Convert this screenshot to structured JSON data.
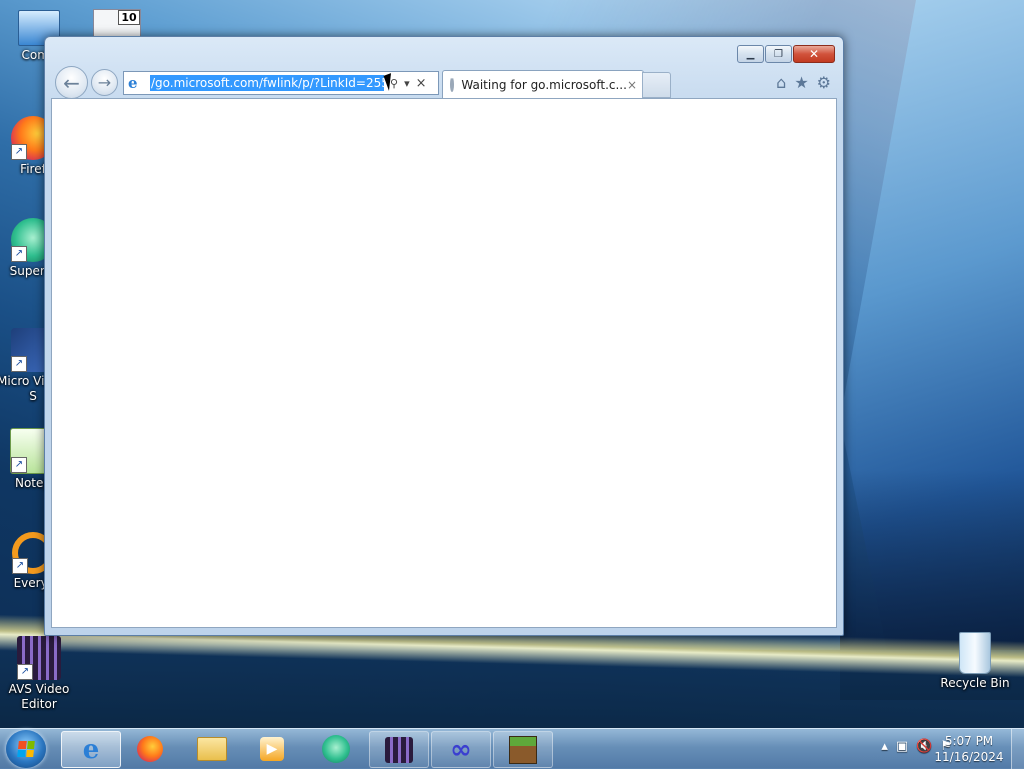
{
  "desktop": {
    "icons": [
      {
        "label": "Comp"
      },
      {
        "label": "Firef"
      },
      {
        "label": "Superm"
      },
      {
        "label": "Micro Visual S"
      },
      {
        "label": "Notep"
      },
      {
        "label": "Everyt"
      },
      {
        "label": "AVS Video Editor"
      },
      {
        "label": "Recycle Bin"
      }
    ],
    "badge_number": "10"
  },
  "browser": {
    "address": "/go.microsoft.com/fwlink/p/?LinkId=255141",
    "tab_title": "Waiting for go.microsoft.c...",
    "tab_close": "×",
    "addr_stop": "×",
    "addr_search": "⚲",
    "addr_dropdown": "▾"
  },
  "window_controls": {
    "minimize": "▁",
    "maximize": "❐",
    "close": "✕"
  },
  "taskbar": {
    "time": "5:07 PM",
    "date": "11/16/2024",
    "apps": [
      {
        "name": "Internet Explorer",
        "icon": "ie-icon"
      },
      {
        "name": "Firefox",
        "icon": "firefox-icon"
      },
      {
        "name": "File Explorer",
        "icon": "folder-icon"
      },
      {
        "name": "Media Player",
        "icon": "media-player-icon"
      },
      {
        "name": "Supermium",
        "icon": "browser-icon"
      },
      {
        "name": "AVS Video Editor",
        "icon": "film-icon"
      },
      {
        "name": "Visual Studio",
        "icon": "infinity-icon"
      },
      {
        "name": "Minecraft",
        "icon": "grass-block-icon"
      }
    ]
  },
  "colors": {
    "selection": "#3399ff",
    "window_frame": "#c5d9ee",
    "close_button": "#c23a21"
  }
}
